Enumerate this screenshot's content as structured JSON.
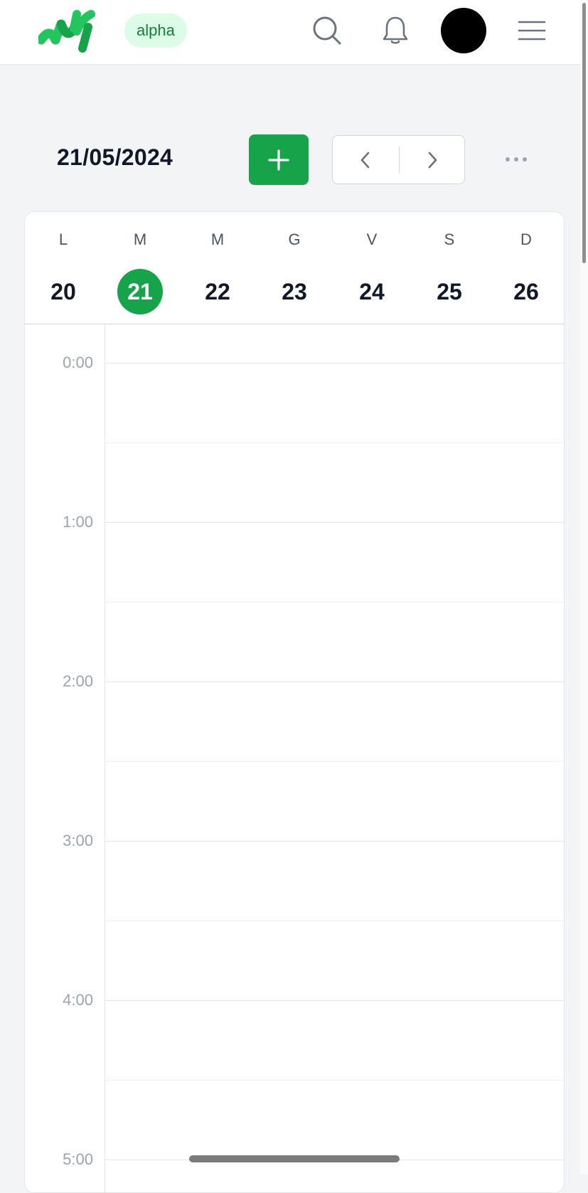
{
  "header": {
    "logo_icon": "brand-logo-icon",
    "badge": "alpha",
    "icons": [
      "search-icon",
      "bell-icon",
      "avatar",
      "menu-icon"
    ],
    "brand_color": "#16a34a"
  },
  "toolbar": {
    "date": "21/05/2024",
    "add_icon": "plus-icon",
    "prev_icon": "chevron-left-icon",
    "next_icon": "chevron-right-icon",
    "more_icon": "more-horizontal-icon"
  },
  "week": {
    "days": [
      {
        "letter": "L",
        "number": "20"
      },
      {
        "letter": "M",
        "number": "21",
        "selected": true
      },
      {
        "letter": "M",
        "number": "22"
      },
      {
        "letter": "G",
        "number": "23"
      },
      {
        "letter": "V",
        "number": "24"
      },
      {
        "letter": "S",
        "number": "25"
      },
      {
        "letter": "D",
        "number": "26"
      }
    ]
  },
  "timeline": {
    "hours": [
      "0:00",
      "1:00",
      "2:00",
      "3:00",
      "4:00",
      "5:00"
    ]
  }
}
